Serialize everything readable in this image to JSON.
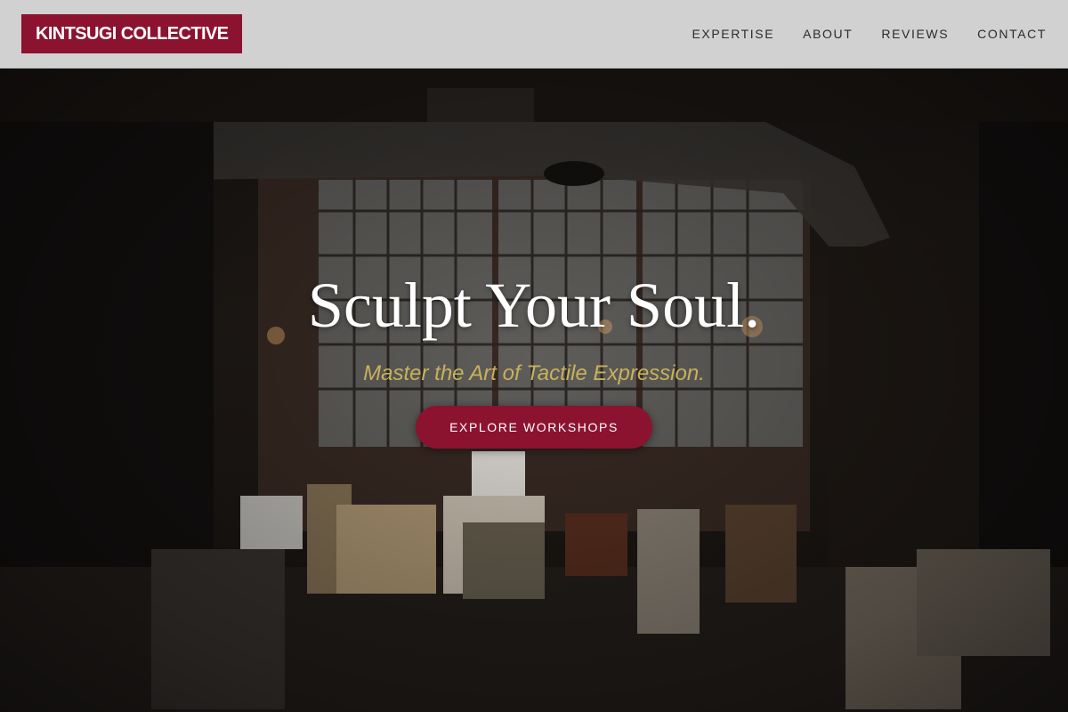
{
  "brand": {
    "name": "KINTSUGI COLLECTIVE",
    "color": "#8c1330"
  },
  "nav": {
    "items": [
      {
        "label": "EXPERTISE"
      },
      {
        "label": "ABOUT"
      },
      {
        "label": "REVIEWS"
      },
      {
        "label": "CONTACT"
      }
    ]
  },
  "hero": {
    "title": "Sculpt Your Soul.",
    "subtitle": "Master the Art of Tactile Expression.",
    "cta_label": "EXPLORE WORKSHOPS",
    "background": "dark-art-studio-photo"
  },
  "colors": {
    "accent": "#8c1330",
    "subtitle": "#c9b15a",
    "header_bg": "#d1d1d1"
  }
}
